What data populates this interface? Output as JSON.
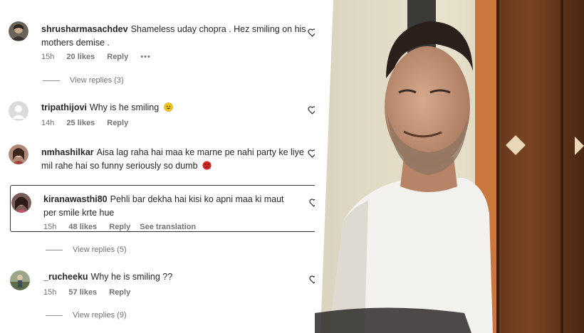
{
  "comments": [
    {
      "username": "shrusharmasachdev",
      "text": "Shameless uday chopra . Hez smiling on his mothers demise .",
      "time": "15h",
      "likes": "20 likes",
      "reply": "Reply",
      "more": "•••",
      "view_replies": "View replies (3)"
    },
    {
      "username": "tripathijovi",
      "text": "Why is he smiling",
      "time": "14h",
      "likes": "25 likes",
      "reply": "Reply"
    },
    {
      "username": "nmhashilkar",
      "text": "Aisa lag raha hai maa ke marne pe nahi party ke liye mil rahe hai so funny seriously so dumb",
      "time": "",
      "likes": "",
      "reply": ""
    },
    {
      "username": "kiranawasthi80",
      "text": "Pehli bar dekha hai kisi ko apni maa ki maut per smile krte hue",
      "time": "15h",
      "likes": "48 likes",
      "reply": "Reply",
      "see_translation": "See translation",
      "view_replies": "View replies (5)"
    },
    {
      "username": "_rucheeku",
      "text": "Why he is smiling ??",
      "time": "15h",
      "likes": "57 likes",
      "reply": "Reply",
      "view_replies": "View replies (9)"
    }
  ],
  "icons": {
    "like": "heart-outline-icon",
    "emoji_sweat": "grinning-sweat-emoji",
    "emoji_angry": "angry-face-emoji"
  },
  "colors": {
    "text": "#262626",
    "meta": "#737373",
    "emoji_yellow": "#f5c518",
    "emoji_red": "#d7261e"
  }
}
